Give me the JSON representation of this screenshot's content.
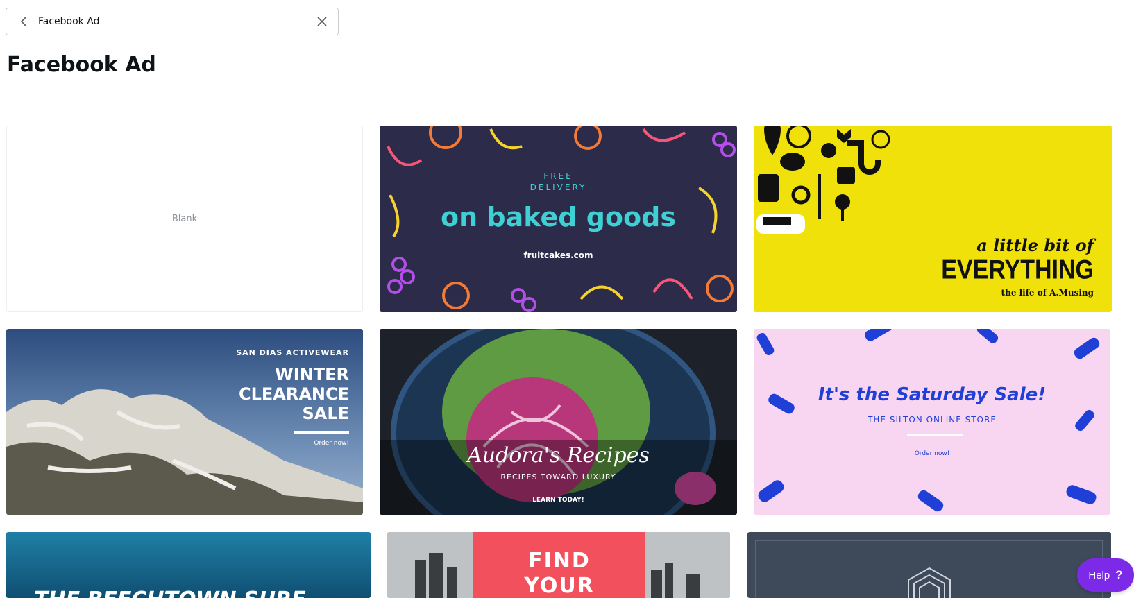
{
  "search": {
    "value": "Facebook Ad",
    "back_icon": "chevron-left-icon",
    "clear_icon": "close-icon"
  },
  "page_title": "Facebook Ad",
  "templates": {
    "blank": {
      "label": "Blank"
    },
    "baked_goods": {
      "line1": "FREE",
      "line2": "DELIVERY",
      "headline": "on baked goods",
      "site": "fruitcakes.com"
    },
    "everything": {
      "line1": "a little bit of",
      "line2": "EVERYTHING",
      "line3": "the life of A.Musing"
    },
    "winter": {
      "brand": "SAN DIAS ACTIVEWEAR",
      "line1": "WINTER",
      "line2": "CLEARANCE",
      "line3": "SALE",
      "cta": "Order now!"
    },
    "audora": {
      "title": "Audora's Recipes",
      "subtitle": "RECIPES TOWARD LUXURY",
      "cta": "LEARN TODAY!"
    },
    "saturday": {
      "title": "It's the Saturday Sale!",
      "subtitle": "THE SILTON ONLINE STORE",
      "cta": "Order now!"
    },
    "beach": {
      "title": "THE BEECHTOWN SURF"
    },
    "find": {
      "line1": "FIND",
      "line2": "YOUR"
    }
  },
  "help": {
    "label": "Help",
    "icon": "question-mark-icon"
  },
  "colors": {
    "accent_purple": "#7d2ae8",
    "baked_bg": "#2c2b4a",
    "baked_headline": "#3fd0d4",
    "yellow_bg": "#f1e10b",
    "pink_bg": "#f8d6f1",
    "saturday_blue": "#1f3fd6",
    "find_red": "#f2505d"
  }
}
